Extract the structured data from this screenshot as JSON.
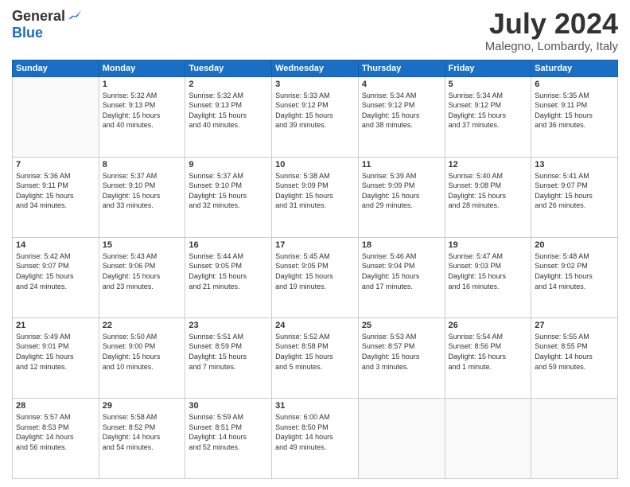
{
  "logo": {
    "general": "General",
    "blue": "Blue"
  },
  "header": {
    "month": "July 2024",
    "location": "Malegno, Lombardy, Italy"
  },
  "weekdays": [
    "Sunday",
    "Monday",
    "Tuesday",
    "Wednesday",
    "Thursday",
    "Friday",
    "Saturday"
  ],
  "weeks": [
    [
      {
        "day": "",
        "info": ""
      },
      {
        "day": "1",
        "info": "Sunrise: 5:32 AM\nSunset: 9:13 PM\nDaylight: 15 hours\nand 40 minutes."
      },
      {
        "day": "2",
        "info": "Sunrise: 5:32 AM\nSunset: 9:13 PM\nDaylight: 15 hours\nand 40 minutes."
      },
      {
        "day": "3",
        "info": "Sunrise: 5:33 AM\nSunset: 9:12 PM\nDaylight: 15 hours\nand 39 minutes."
      },
      {
        "day": "4",
        "info": "Sunrise: 5:34 AM\nSunset: 9:12 PM\nDaylight: 15 hours\nand 38 minutes."
      },
      {
        "day": "5",
        "info": "Sunrise: 5:34 AM\nSunset: 9:12 PM\nDaylight: 15 hours\nand 37 minutes."
      },
      {
        "day": "6",
        "info": "Sunrise: 5:35 AM\nSunset: 9:11 PM\nDaylight: 15 hours\nand 36 minutes."
      }
    ],
    [
      {
        "day": "7",
        "info": "Sunrise: 5:36 AM\nSunset: 9:11 PM\nDaylight: 15 hours\nand 34 minutes."
      },
      {
        "day": "8",
        "info": "Sunrise: 5:37 AM\nSunset: 9:10 PM\nDaylight: 15 hours\nand 33 minutes."
      },
      {
        "day": "9",
        "info": "Sunrise: 5:37 AM\nSunset: 9:10 PM\nDaylight: 15 hours\nand 32 minutes."
      },
      {
        "day": "10",
        "info": "Sunrise: 5:38 AM\nSunset: 9:09 PM\nDaylight: 15 hours\nand 31 minutes."
      },
      {
        "day": "11",
        "info": "Sunrise: 5:39 AM\nSunset: 9:09 PM\nDaylight: 15 hours\nand 29 minutes."
      },
      {
        "day": "12",
        "info": "Sunrise: 5:40 AM\nSunset: 9:08 PM\nDaylight: 15 hours\nand 28 minutes."
      },
      {
        "day": "13",
        "info": "Sunrise: 5:41 AM\nSunset: 9:07 PM\nDaylight: 15 hours\nand 26 minutes."
      }
    ],
    [
      {
        "day": "14",
        "info": "Sunrise: 5:42 AM\nSunset: 9:07 PM\nDaylight: 15 hours\nand 24 minutes."
      },
      {
        "day": "15",
        "info": "Sunrise: 5:43 AM\nSunset: 9:06 PM\nDaylight: 15 hours\nand 23 minutes."
      },
      {
        "day": "16",
        "info": "Sunrise: 5:44 AM\nSunset: 9:05 PM\nDaylight: 15 hours\nand 21 minutes."
      },
      {
        "day": "17",
        "info": "Sunrise: 5:45 AM\nSunset: 9:05 PM\nDaylight: 15 hours\nand 19 minutes."
      },
      {
        "day": "18",
        "info": "Sunrise: 5:46 AM\nSunset: 9:04 PM\nDaylight: 15 hours\nand 17 minutes."
      },
      {
        "day": "19",
        "info": "Sunrise: 5:47 AM\nSunset: 9:03 PM\nDaylight: 15 hours\nand 16 minutes."
      },
      {
        "day": "20",
        "info": "Sunrise: 5:48 AM\nSunset: 9:02 PM\nDaylight: 15 hours\nand 14 minutes."
      }
    ],
    [
      {
        "day": "21",
        "info": "Sunrise: 5:49 AM\nSunset: 9:01 PM\nDaylight: 15 hours\nand 12 minutes."
      },
      {
        "day": "22",
        "info": "Sunrise: 5:50 AM\nSunset: 9:00 PM\nDaylight: 15 hours\nand 10 minutes."
      },
      {
        "day": "23",
        "info": "Sunrise: 5:51 AM\nSunset: 8:59 PM\nDaylight: 15 hours\nand 7 minutes."
      },
      {
        "day": "24",
        "info": "Sunrise: 5:52 AM\nSunset: 8:58 PM\nDaylight: 15 hours\nand 5 minutes."
      },
      {
        "day": "25",
        "info": "Sunrise: 5:53 AM\nSunset: 8:57 PM\nDaylight: 15 hours\nand 3 minutes."
      },
      {
        "day": "26",
        "info": "Sunrise: 5:54 AM\nSunset: 8:56 PM\nDaylight: 15 hours\nand 1 minute."
      },
      {
        "day": "27",
        "info": "Sunrise: 5:55 AM\nSunset: 8:55 PM\nDaylight: 14 hours\nand 59 minutes."
      }
    ],
    [
      {
        "day": "28",
        "info": "Sunrise: 5:57 AM\nSunset: 8:53 PM\nDaylight: 14 hours\nand 56 minutes."
      },
      {
        "day": "29",
        "info": "Sunrise: 5:58 AM\nSunset: 8:52 PM\nDaylight: 14 hours\nand 54 minutes."
      },
      {
        "day": "30",
        "info": "Sunrise: 5:59 AM\nSunset: 8:51 PM\nDaylight: 14 hours\nand 52 minutes."
      },
      {
        "day": "31",
        "info": "Sunrise: 6:00 AM\nSunset: 8:50 PM\nDaylight: 14 hours\nand 49 minutes."
      },
      {
        "day": "",
        "info": ""
      },
      {
        "day": "",
        "info": ""
      },
      {
        "day": "",
        "info": ""
      }
    ]
  ]
}
